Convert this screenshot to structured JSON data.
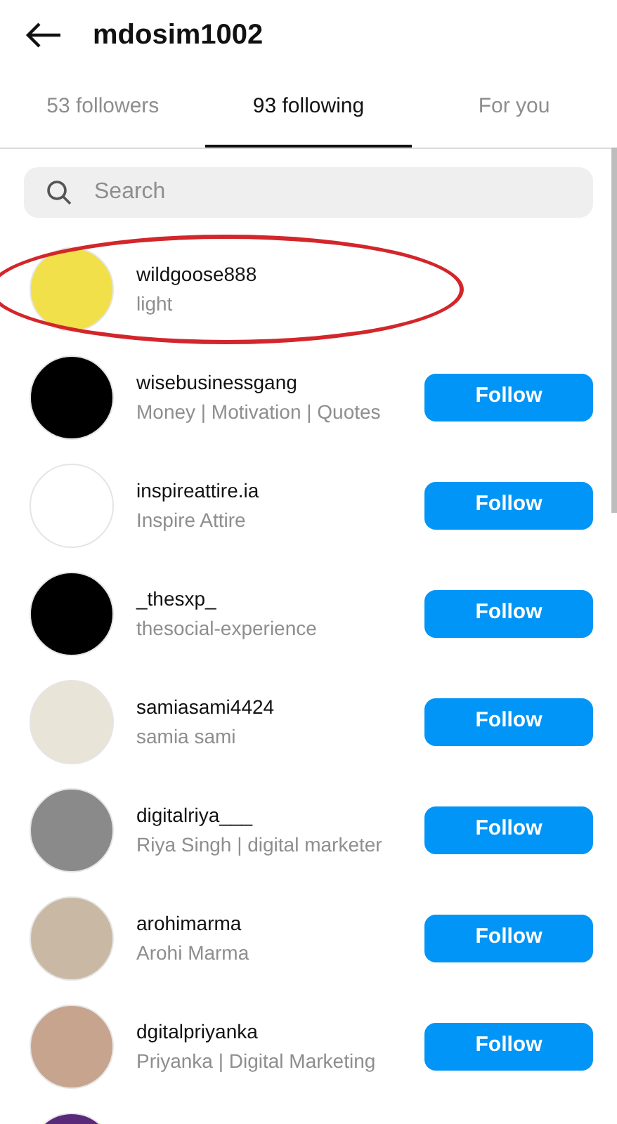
{
  "header": {
    "title": "mdosim1002"
  },
  "tabs": [
    {
      "label": "53 followers",
      "selected": false
    },
    {
      "label": "93 following",
      "selected": true
    },
    {
      "label": "For you",
      "selected": false
    }
  ],
  "search": {
    "placeholder": "Search"
  },
  "accounts": [
    {
      "kind": "account",
      "username": "wildgoose888",
      "name": "light",
      "color": "#f2e04a",
      "circled": true
    },
    {
      "kind": "account",
      "username": "wisebusinessgang",
      "name": "Money | Motivation | Quotes",
      "color": "#000000",
      "circled": false,
      "button": "Follow"
    },
    {
      "kind": "account",
      "username": "inspireattire.ia",
      "name": "Inspire Attire",
      "color": "#ffffff",
      "circled": false,
      "button": "Follow"
    },
    {
      "kind": "account",
      "username": "_thesxp_",
      "name": "thesocial-experience",
      "color": "#000000",
      "circled": false,
      "button": "Follow"
    },
    {
      "kind": "account",
      "username": "samiasami4424",
      "name": "samia sami",
      "color": "#e9e4d8",
      "circled": false,
      "button": "Follow"
    },
    {
      "kind": "account",
      "username": "digitalriya___",
      "name": "Riya Singh | digital marketer",
      "color": "#8a8a8a",
      "circled": false,
      "button": "Follow"
    },
    {
      "kind": "account",
      "username": "arohimarma",
      "name": "Arohi Marma",
      "color": "#c9b9a4",
      "circled": false,
      "button": "Follow"
    },
    {
      "kind": "account",
      "username": "dgitalpriyanka",
      "name": "Priyanka | Digital Marketing",
      "color": "#c7a48e",
      "circled": false,
      "button": "Follow"
    },
    {
      "kind": "cut_off",
      "color": "#5a2a7a"
    }
  ]
}
